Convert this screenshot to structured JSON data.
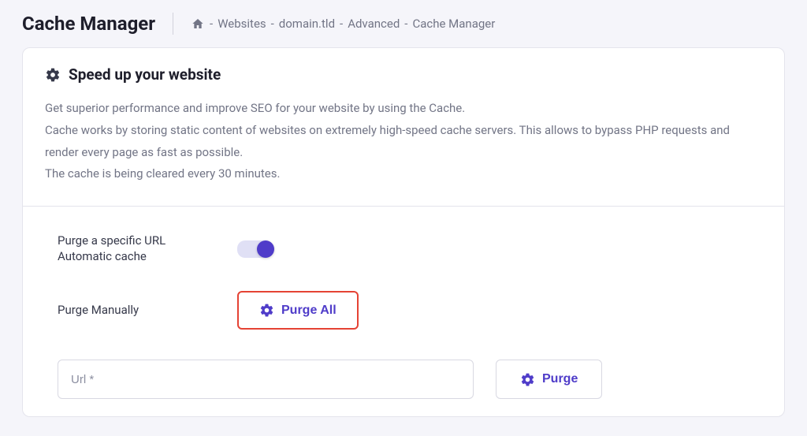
{
  "page": {
    "title": "Cache Manager"
  },
  "breadcrumb": {
    "items": [
      "Websites",
      "domain.tld",
      "Advanced",
      "Cache Manager"
    ]
  },
  "card": {
    "heading": "Speed up your website",
    "description": "Get superior performance and improve SEO for your website by using the Cache.\nCache works by storing static content of websites on extremely high-speed cache servers. This allows to bypass PHP requests and render every page as fast as possible.\nThe cache is being cleared every 30 minutes."
  },
  "form": {
    "purge_specific_url_label": "Purge a specific URL",
    "automatic_cache_label": "Automatic cache",
    "automatic_cache_on": true,
    "purge_manually_label": "Purge Manually",
    "purge_all_button": "Purge All",
    "url_placeholder": "Url *",
    "url_value": "",
    "purge_button": "Purge"
  },
  "colors": {
    "accent": "#4f3cc9",
    "highlight_border": "#e54334"
  }
}
